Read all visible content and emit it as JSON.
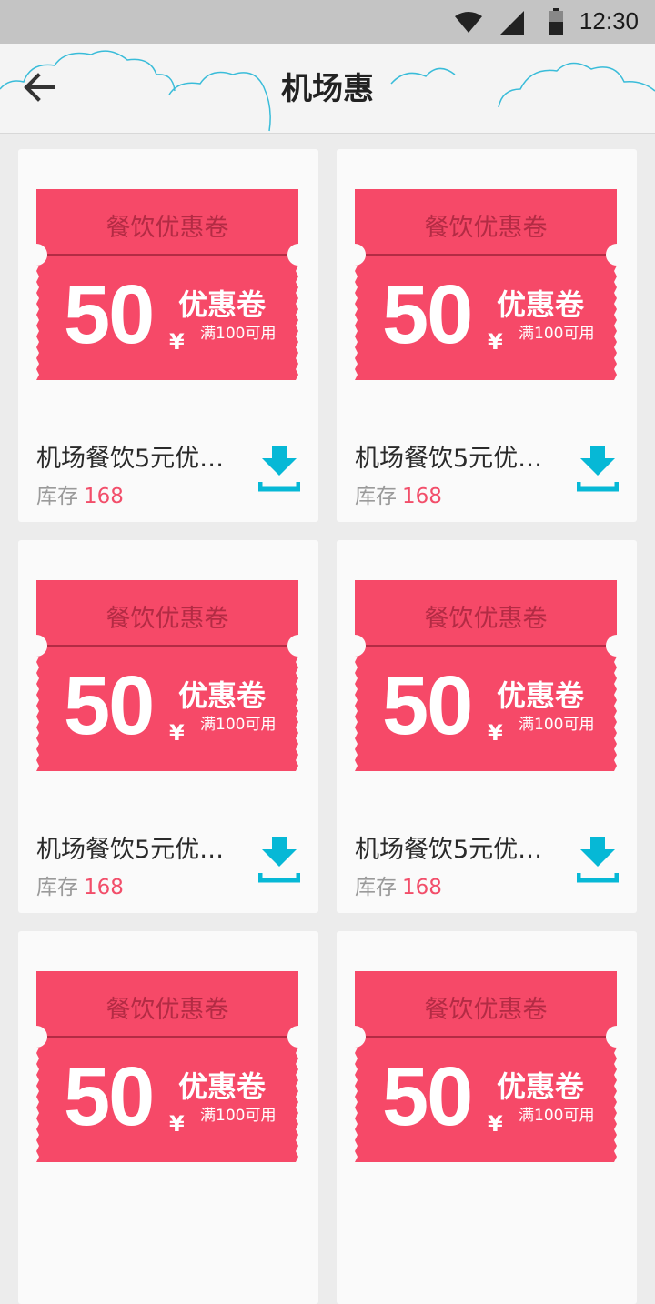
{
  "status_bar": {
    "time": "12:30"
  },
  "header": {
    "title": "机场惠"
  },
  "colors": {
    "coupon": "#f64968",
    "accent": "#06b8d6",
    "stock_number": "#f24e6a"
  },
  "coupons": [
    {
      "label": "餐饮优惠卷",
      "amount": "50",
      "currency": "¥",
      "title": "优惠卷",
      "condition": "满100可用",
      "name": "机场餐饮5元优…",
      "stock_label": "库存",
      "stock": "168"
    },
    {
      "label": "餐饮优惠卷",
      "amount": "50",
      "currency": "¥",
      "title": "优惠卷",
      "condition": "满100可用",
      "name": "机场餐饮5元优…",
      "stock_label": "库存",
      "stock": "168"
    },
    {
      "label": "餐饮优惠卷",
      "amount": "50",
      "currency": "¥",
      "title": "优惠卷",
      "condition": "满100可用",
      "name": "机场餐饮5元优…",
      "stock_label": "库存",
      "stock": "168"
    },
    {
      "label": "餐饮优惠卷",
      "amount": "50",
      "currency": "¥",
      "title": "优惠卷",
      "condition": "满100可用",
      "name": "机场餐饮5元优…",
      "stock_label": "库存",
      "stock": "168"
    },
    {
      "label": "餐饮优惠卷",
      "amount": "50",
      "currency": "¥",
      "title": "优惠卷",
      "condition": "满100可用",
      "name": "",
      "stock_label": "",
      "stock": ""
    },
    {
      "label": "餐饮优惠卷",
      "amount": "50",
      "currency": "¥",
      "title": "优惠卷",
      "condition": "满100可用",
      "name": "",
      "stock_label": "",
      "stock": ""
    }
  ]
}
